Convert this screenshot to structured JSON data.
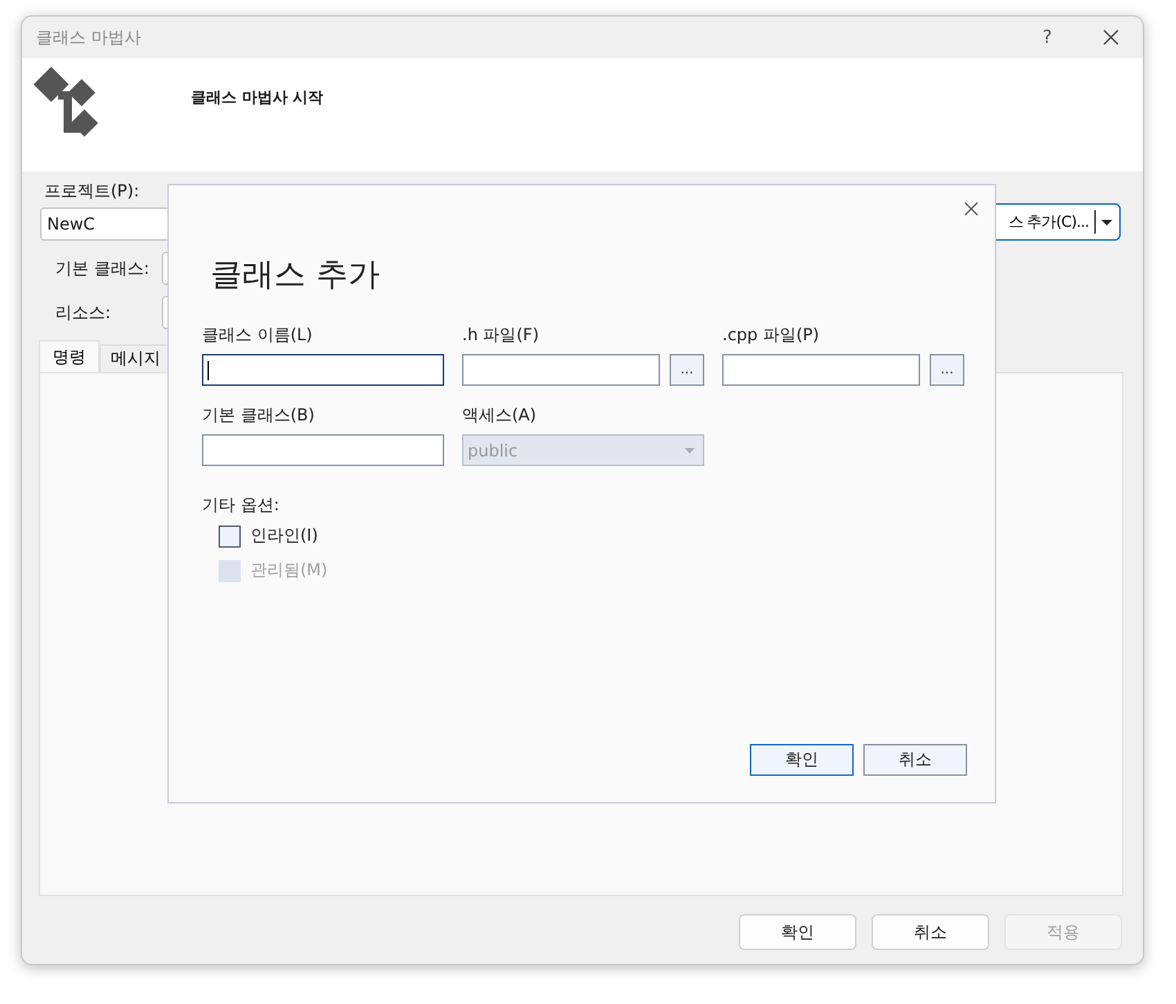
{
  "window": {
    "title": "클래스 마법사",
    "help": "?"
  },
  "header": {
    "title": "클래스 마법사 시작"
  },
  "form": {
    "project_label": "프로젝트(P):",
    "project_value": "NewC",
    "base_class_label": "기본 클래스:",
    "resource_label": "리소스:",
    "add_class_button": "스 추가(C)..."
  },
  "tabs": [
    {
      "label": "명령",
      "selected": true
    },
    {
      "label": "메시지",
      "selected": false
    }
  ],
  "buttons": [
    {
      "label": "확인",
      "disabled": false
    },
    {
      "label": "취소",
      "disabled": false
    },
    {
      "label": "적용",
      "disabled": true
    }
  ],
  "dialog": {
    "title": "클래스 추가",
    "fields": [
      {
        "label": "클래스 이름(L)",
        "kind": "text",
        "focused": true
      },
      {
        "label": ".h 파일(F)",
        "kind": "browse",
        "browse": "...",
        "focused": false
      },
      {
        "label": ".cpp 파일(P)",
        "kind": "browse",
        "browse": "...",
        "focused": false
      },
      {
        "label": "기본 클래스(B)",
        "kind": "text",
        "focused": false
      },
      {
        "label": "액세스(A)",
        "kind": "combo",
        "value": "public",
        "disabled": true
      }
    ],
    "options_label": "기타 옵션:",
    "options": [
      {
        "label": "인라인(I)",
        "checked": false,
        "disabled": false
      },
      {
        "label": "관리됨(M)",
        "checked": false,
        "disabled": true
      }
    ],
    "buttons": [
      {
        "label": "확인",
        "default": true
      },
      {
        "label": "취소",
        "default": false
      }
    ]
  }
}
